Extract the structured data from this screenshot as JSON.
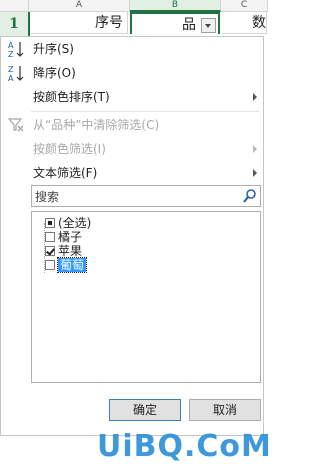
{
  "sheet": {
    "columns": [
      "A",
      "B",
      "C"
    ],
    "row_number": "1",
    "cell_a1": "序号",
    "cell_b1": "品",
    "cell_c1": "数"
  },
  "menu": {
    "sort_asc": "升序(S)",
    "sort_desc": "降序(O)",
    "sort_by_color": "按颜色排序(T)",
    "clear_filter": "从“品种”中清除筛选(C)",
    "filter_by_color": "按颜色筛选(I)",
    "text_filter": "文本筛选(F)"
  },
  "search": {
    "placeholder": "搜索"
  },
  "filter_list": [
    {
      "label": "(全选)",
      "state": "partial"
    },
    {
      "label": "橘子",
      "state": "unchecked"
    },
    {
      "label": "苹果",
      "state": "checked"
    },
    {
      "label": "葡萄",
      "state": "unchecked"
    }
  ],
  "buttons": {
    "ok": "确定",
    "cancel": "取消"
  },
  "watermark": "UiBQ.CoM",
  "colors": {
    "accent": "#217346",
    "selection": "#3399ff",
    "watermark": "#2a8fd6"
  }
}
